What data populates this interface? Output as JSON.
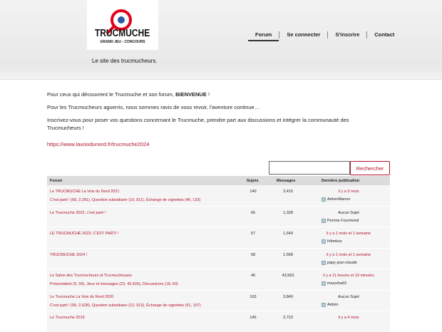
{
  "header": {
    "logo_text": "TRUCMUCHE",
    "logo_subtext": "GRAND JEU - CONCOURS",
    "tagline": "Le site des trucmucheurs."
  },
  "nav": [
    "Forum",
    "Se connecter",
    "S'inscrire",
    "Contact"
  ],
  "intro": {
    "p1_prefix": "Pour ceux qui découvrent le Trucmuche et son forum, ",
    "p1_bold": "BIENVENUE",
    "p1_suffix": " !",
    "p2": "Pour les Trucmucheurs aguerris, nous sommes ravis de vous revoir, l'aventure continue…",
    "p3": "Inscrivez-vous pour poser vos questions concernant le Trucmuche, prendre part aux discussions et intégrer la communauté des Trucmucheurs !",
    "link": "https://www.lavoixdunord.fr/trucmuche2024"
  },
  "search": {
    "button": "Rechercher",
    "value": ""
  },
  "table": {
    "headers": {
      "forum": "Forum",
      "sujets": "Sujets",
      "messages": "Messages",
      "last": "Dernière publication"
    },
    "rows": [
      {
        "title": "Le TRUCMUCHE La Voix du Nord 2021",
        "subs": "C'est parti ! (68, 2,281), Question subsidiaire (10, 811), Échange de vignettes (46, 133)",
        "sujets": "140",
        "messages": "3,415",
        "last": "il y a 3 mois",
        "last_plain": false,
        "author": "AdminManon"
      },
      {
        "title": "Le Trucmuche 2022, c'est parti !",
        "subs": "",
        "sujets": "66",
        "messages": "1,328",
        "last": "Aucun Sujet",
        "last_plain": true,
        "author": "Perrine Fourmond"
      },
      {
        "title": "LE TRUCMUCHE 2023, C'EST PARTI !",
        "subs": "",
        "sujets": "57",
        "messages": "1,649",
        "last": "il y a 1 mois et 1 semaine",
        "last_plain": false,
        "author": "fribmkss"
      },
      {
        "title": "TRUCMUCHE 2024 !",
        "subs": "",
        "sujets": "58",
        "messages": "1,568",
        "last": "il y a 1 mois et 1 semaine",
        "last_plain": false,
        "author": "papy jean-claude"
      },
      {
        "title": "Le Salon des Trucmucheurs et Trucmucheuses",
        "subs": "Présentation (5, 59), Jeux et messages (23, 43,426), Discussions (18, 60)",
        "sujets": "46",
        "messages": "43,563",
        "last": "il y a 11 heures et 19 minutes",
        "last_plain": false,
        "author": "marysha62"
      },
      {
        "title": "Le Trucmuche La Voix du Nord 2020",
        "subs": "C'est parti ! (99, 2,628), Question subsidiaire (12, 913), Échange de vignettes (61, 107)",
        "sujets": "163",
        "messages": "3,840",
        "last": "Aucun Sujet",
        "last_plain": true,
        "author": "Admin"
      },
      {
        "title": "Le Trucmuche 2019",
        "subs": "",
        "sujets": "145",
        "messages": "2,723",
        "last": "il y a 4 mois",
        "last_plain": false,
        "author": ""
      }
    ]
  }
}
